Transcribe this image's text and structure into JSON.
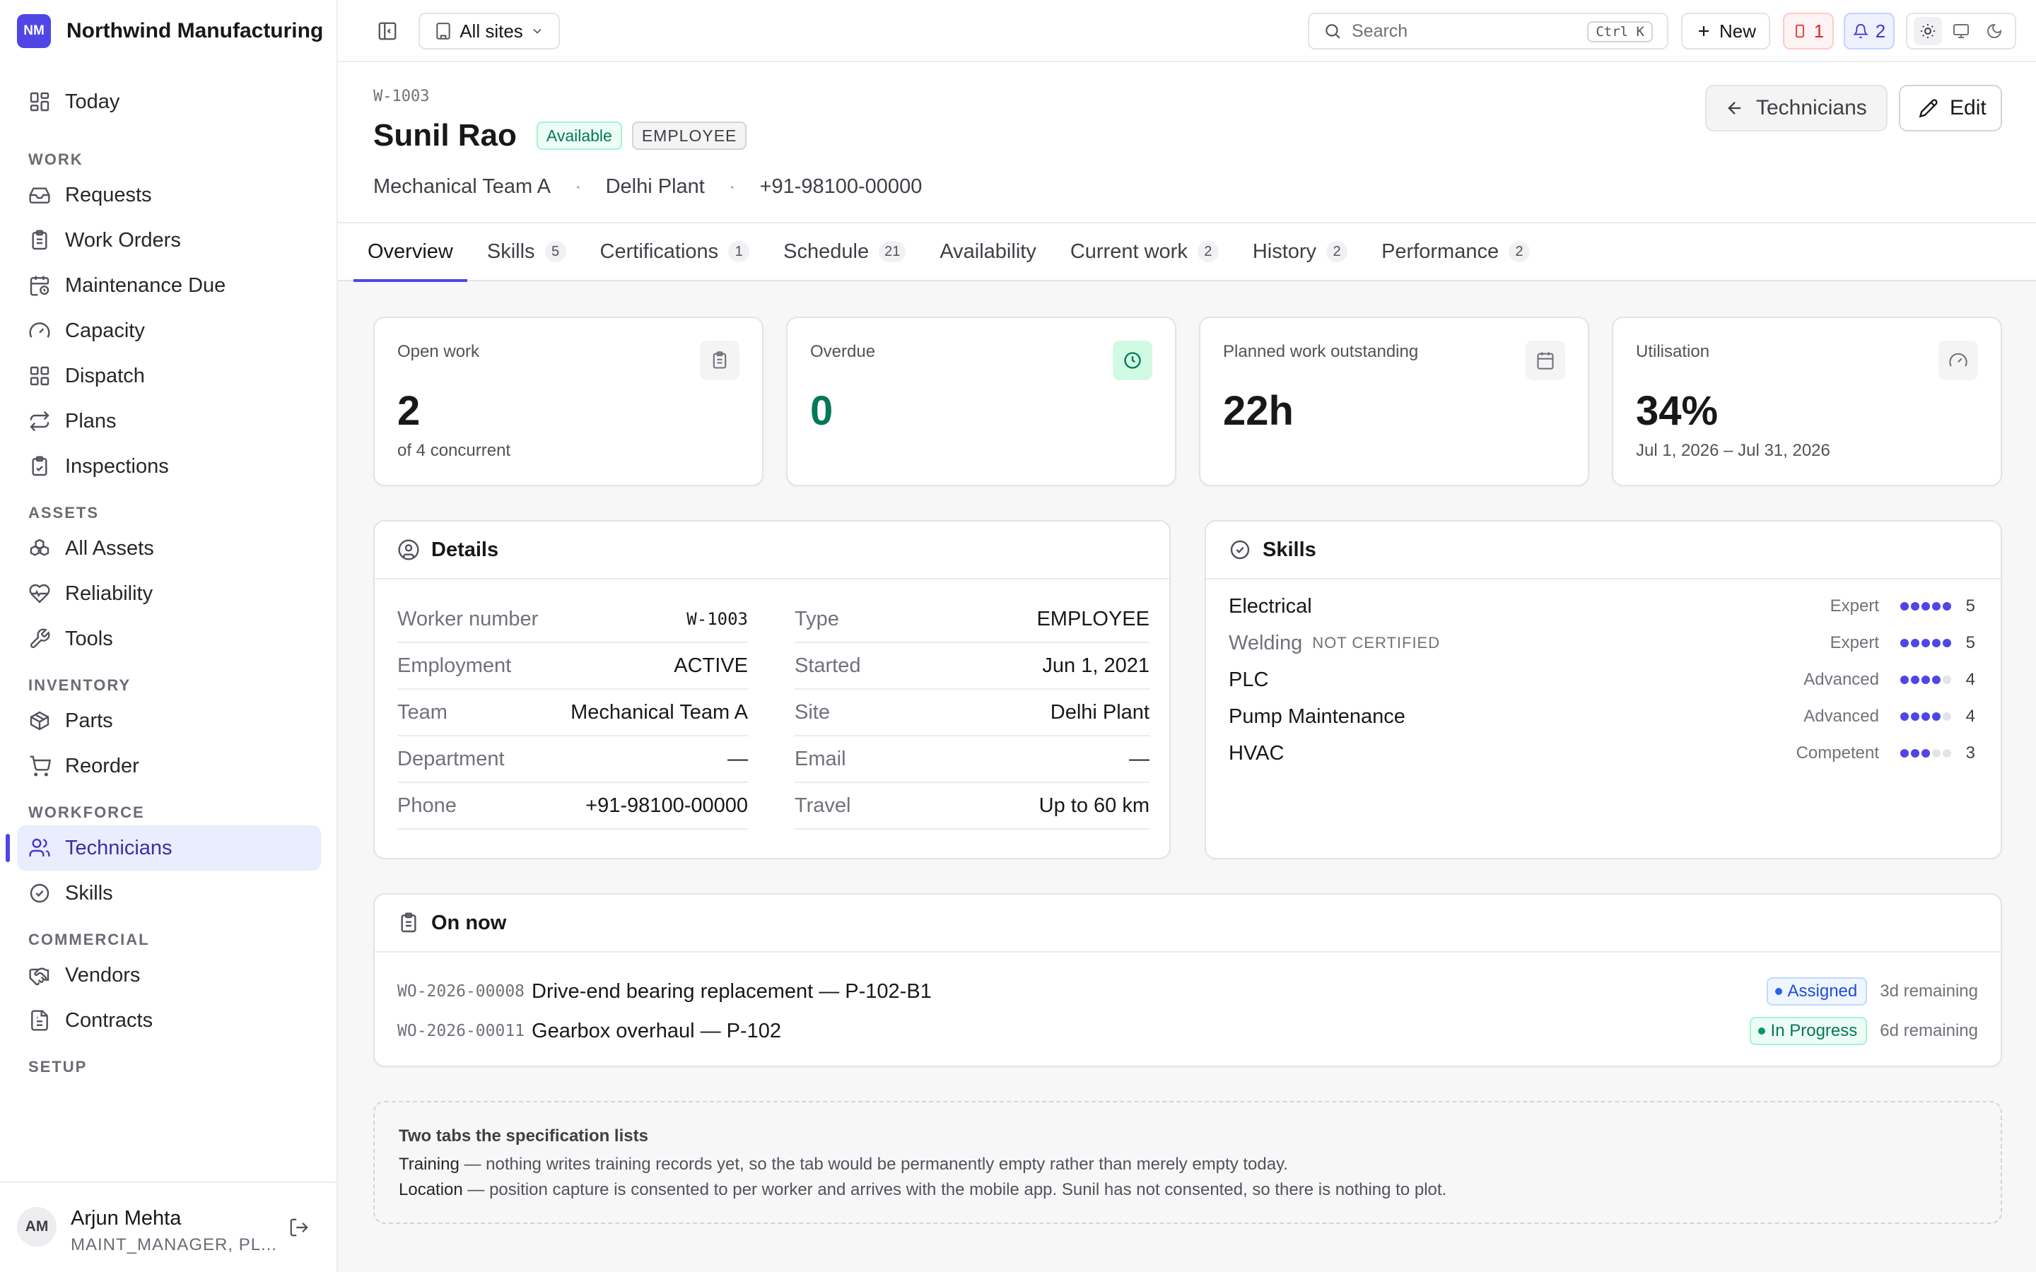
{
  "brand": {
    "initials": "NM",
    "name": "Northwind Manufacturing"
  },
  "sidebar": {
    "top_item": {
      "label": "Today",
      "icon": "dashboard-icon"
    },
    "groups": [
      {
        "title": "WORK",
        "items": [
          {
            "label": "Requests",
            "icon": "inbox-icon"
          },
          {
            "label": "Work Orders",
            "icon": "clipboard-icon"
          },
          {
            "label": "Maintenance Due",
            "icon": "calendar-clock-icon"
          },
          {
            "label": "Capacity",
            "icon": "gauge-icon"
          },
          {
            "label": "Dispatch",
            "icon": "grid-icon"
          },
          {
            "label": "Plans",
            "icon": "repeat-icon"
          },
          {
            "label": "Inspections",
            "icon": "clipboard-check-icon"
          }
        ]
      },
      {
        "title": "ASSETS",
        "items": [
          {
            "label": "All Assets",
            "icon": "boxes-icon"
          },
          {
            "label": "Reliability",
            "icon": "heart-pulse-icon"
          },
          {
            "label": "Tools",
            "icon": "wrench-icon"
          }
        ]
      },
      {
        "title": "INVENTORY",
        "items": [
          {
            "label": "Parts",
            "icon": "package-icon"
          },
          {
            "label": "Reorder",
            "icon": "cart-icon"
          }
        ]
      },
      {
        "title": "WORKFORCE",
        "items": [
          {
            "label": "Technicians",
            "icon": "users-icon",
            "active": true
          },
          {
            "label": "Skills",
            "icon": "badge-check-icon"
          }
        ]
      },
      {
        "title": "COMMERCIAL",
        "items": [
          {
            "label": "Vendors",
            "icon": "handshake-icon"
          },
          {
            "label": "Contracts",
            "icon": "file-text-icon"
          }
        ]
      },
      {
        "title": "SETUP",
        "items": []
      }
    ],
    "user": {
      "initials": "AM",
      "name": "Arjun Mehta",
      "role": "MAINT_MANAGER, PL..."
    }
  },
  "topbar": {
    "site_selector": "All sites",
    "search_placeholder": "Search",
    "search_shortcut": "Ctrl K",
    "new_label": "New",
    "alert_count": "1",
    "notification_count": "2"
  },
  "header": {
    "worker_code": "W-1003",
    "name": "Sunil Rao",
    "status": "Available",
    "type_badge": "EMPLOYEE",
    "team": "Mechanical Team A",
    "site": "Delhi Plant",
    "phone": "+91-98100-00000",
    "back_label": "Technicians",
    "edit_label": "Edit"
  },
  "tabs": [
    {
      "label": "Overview",
      "count": "",
      "active": true
    },
    {
      "label": "Skills",
      "count": "5"
    },
    {
      "label": "Certifications",
      "count": "1"
    },
    {
      "label": "Schedule",
      "count": "21"
    },
    {
      "label": "Availability",
      "count": ""
    },
    {
      "label": "Current work",
      "count": "2"
    },
    {
      "label": "History",
      "count": "2"
    },
    {
      "label": "Performance",
      "count": "2"
    }
  ],
  "kpis": [
    {
      "label": "Open work",
      "value": "2",
      "sub": "of 4 concurrent"
    },
    {
      "label": "Overdue",
      "value": "0",
      "sub": ""
    },
    {
      "label": "Planned work outstanding",
      "value": "22h",
      "sub": ""
    },
    {
      "label": "Utilisation",
      "value": "34%",
      "sub": "Jul 1, 2026 – Jul 31, 2026"
    }
  ],
  "details": {
    "title": "Details",
    "left": [
      {
        "label": "Worker number",
        "value": "W-1003"
      },
      {
        "label": "Employment",
        "value": "ACTIVE"
      },
      {
        "label": "Team",
        "value": "Mechanical Team A"
      },
      {
        "label": "Department",
        "value": "—"
      },
      {
        "label": "Phone",
        "value": "+91-98100-00000"
      }
    ],
    "right": [
      {
        "label": "Type",
        "value": "EMPLOYEE"
      },
      {
        "label": "Started",
        "value": "Jun 1, 2021"
      },
      {
        "label": "Site",
        "value": "Delhi Plant"
      },
      {
        "label": "Email",
        "value": "—"
      },
      {
        "label": "Travel",
        "value": "Up to 60 km"
      }
    ]
  },
  "skills": {
    "title": "Skills",
    "items": [
      {
        "name": "Electrical",
        "note": "",
        "level": "Expert",
        "rating": 5
      },
      {
        "name": "Welding",
        "note": "NOT CERTIFIED",
        "level": "Expert",
        "rating": 5
      },
      {
        "name": "PLC",
        "note": "",
        "level": "Advanced",
        "rating": 4
      },
      {
        "name": "Pump Maintenance",
        "note": "",
        "level": "Advanced",
        "rating": 4
      },
      {
        "name": "HVAC",
        "note": "",
        "level": "Competent",
        "rating": 3
      }
    ]
  },
  "on_now": {
    "title": "On now",
    "items": [
      {
        "code": "WO-2026-00008",
        "title": "Drive-end bearing replacement — P-102-B1",
        "status": "Assigned",
        "remaining": "3d remaining"
      },
      {
        "code": "WO-2026-00011",
        "title": "Gearbox overhaul — P-102",
        "status": "In Progress",
        "remaining": "6d remaining"
      }
    ]
  },
  "note": {
    "title": "Two tabs the specification lists",
    "lines": [
      {
        "term": "Training",
        "text": " — nothing writes training records yet, so the tab would be permanently empty rather than merely empty today."
      },
      {
        "term": "Location",
        "text": " — position capture is consented to per worker and arrives with the mobile app. Sunil has not consented, so there is nothing to plot."
      }
    ]
  }
}
